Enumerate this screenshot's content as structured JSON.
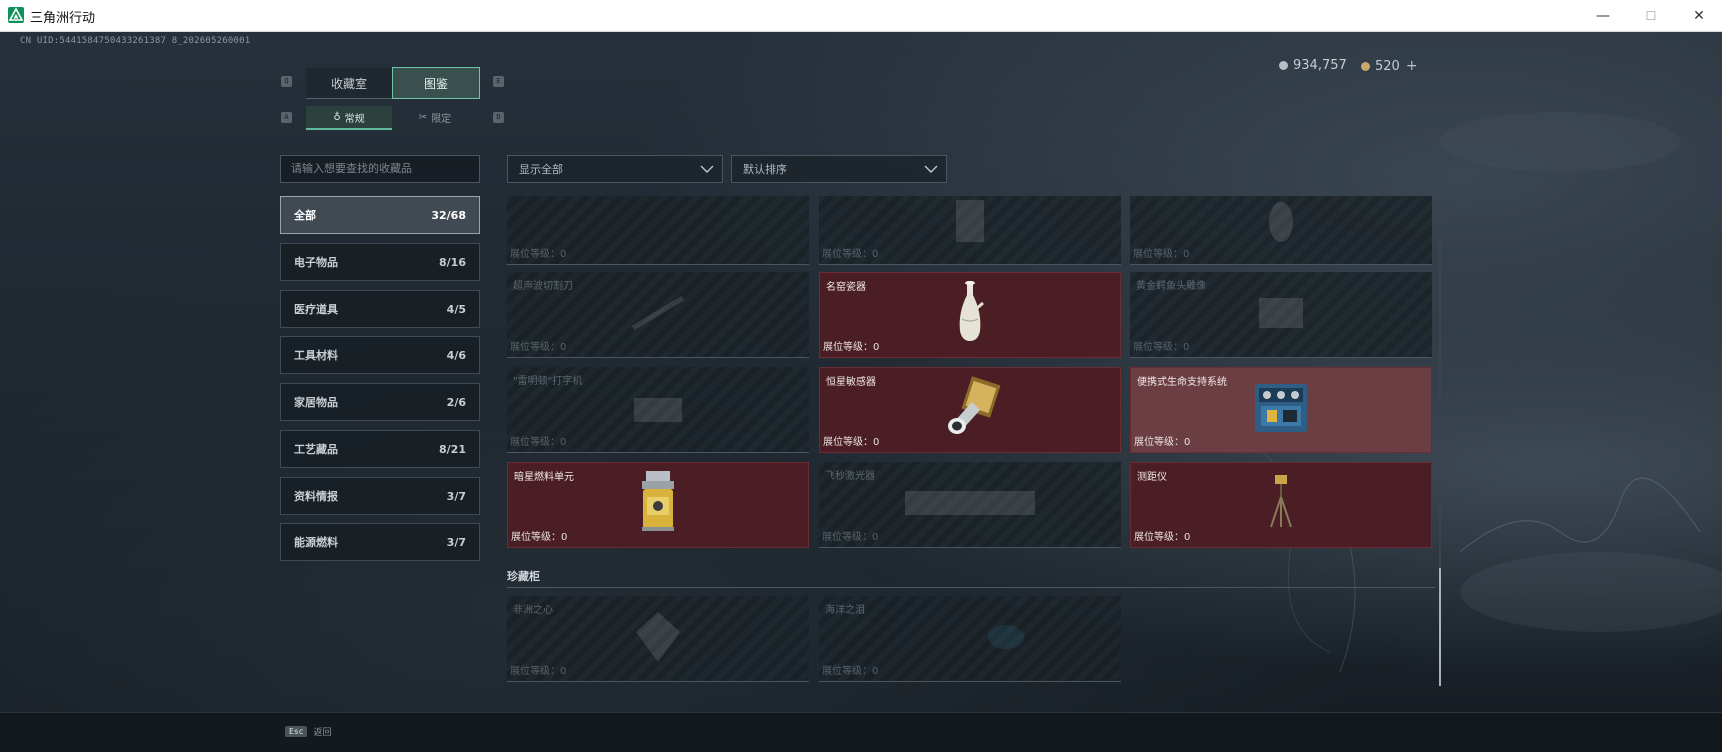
{
  "window": {
    "title": "三角洲行动",
    "minimize": "—",
    "maximize": "☐",
    "close": "✕"
  },
  "uid": "CN UID:5441584750433261387 8_202605260001",
  "currency": {
    "silver": "934,757",
    "gold": "520",
    "plus": "+"
  },
  "tabs": [
    {
      "label": "收藏室",
      "key": "Q"
    },
    {
      "label": "图鉴",
      "key": "E"
    }
  ],
  "subtabs": [
    {
      "label": "常规",
      "key": "A"
    },
    {
      "label": "限定",
      "key": "D"
    }
  ],
  "search": {
    "placeholder": "请输入想要查找的收藏品"
  },
  "categories": [
    {
      "label": "全部",
      "count": "32/68"
    },
    {
      "label": "电子物品",
      "count": "8/16"
    },
    {
      "label": "医疗道具",
      "count": "4/5"
    },
    {
      "label": "工具材料",
      "count": "4/6"
    },
    {
      "label": "家居物品",
      "count": "2/6"
    },
    {
      "label": "工艺藏品",
      "count": "8/21"
    },
    {
      "label": "资料情报",
      "count": "3/7"
    },
    {
      "label": "能源燃料",
      "count": "3/7"
    }
  ],
  "filters": {
    "show": "显示全部",
    "sort": "默认排序"
  },
  "level_label": "展位等级：",
  "cards": [
    {
      "name": "",
      "level": "0",
      "state": "locked"
    },
    {
      "name": "",
      "level": "0",
      "state": "locked"
    },
    {
      "name": "",
      "level": "0",
      "state": "locked"
    },
    {
      "name": "超声波切割刀",
      "level": "0",
      "state": "locked"
    },
    {
      "name": "名窑瓷器",
      "level": "0",
      "state": "owned"
    },
    {
      "name": "黄金鳄鱼头雕像",
      "level": "0",
      "state": "locked"
    },
    {
      "name": "\"雷明顿\"打字机",
      "level": "0",
      "state": "locked"
    },
    {
      "name": "恒星敏感器",
      "level": "0",
      "state": "owned"
    },
    {
      "name": "便携式生命支持系统",
      "level": "0",
      "state": "owned-bright"
    },
    {
      "name": "暗星燃料单元",
      "level": "0",
      "state": "owned"
    },
    {
      "name": "飞秒激光器",
      "level": "0",
      "state": "locked"
    },
    {
      "name": "测距仪",
      "level": "0",
      "state": "owned"
    }
  ],
  "treasure_section": {
    "title": "珍藏柜"
  },
  "treasure_cards": [
    {
      "name": "非洲之心",
      "level": "0",
      "state": "locked"
    },
    {
      "name": "海洋之泪",
      "level": "0",
      "state": "locked"
    }
  ],
  "footer": {
    "esc_key": "Esc",
    "esc_label": "返回"
  },
  "colors": {
    "accent": "#6fc7a9",
    "owned_card": "#4a1e24",
    "owned_card_bright": "#6b3e44"
  }
}
